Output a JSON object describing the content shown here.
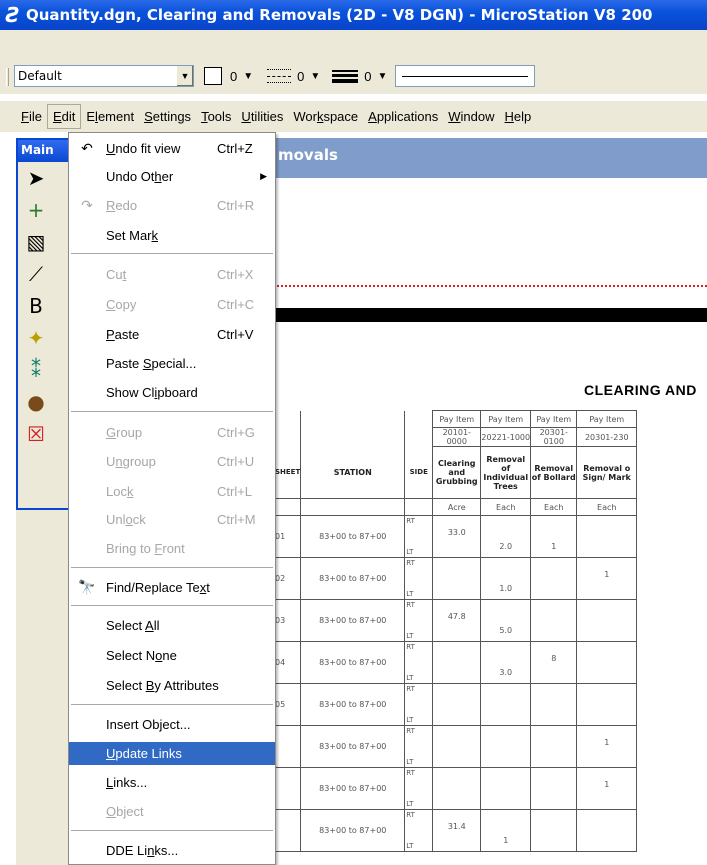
{
  "window": {
    "logo": "Ƨ",
    "title": "Quantity.dgn, Clearing and Removals (2D - V8 DGN) - MicroStation V8 200"
  },
  "toolbar": {
    "level_value": "Default",
    "color_value": "0",
    "style_value": "0",
    "weight_value": "0"
  },
  "menubar": {
    "items": [
      {
        "pre": "",
        "key": "F",
        "post": "ile"
      },
      {
        "pre": "",
        "key": "E",
        "post": "dit"
      },
      {
        "pre": "E",
        "key": "l",
        "post": "ement"
      },
      {
        "pre": "",
        "key": "S",
        "post": "ettings"
      },
      {
        "pre": "",
        "key": "T",
        "post": "ools"
      },
      {
        "pre": "",
        "key": "U",
        "post": "tilities"
      },
      {
        "pre": "Wor",
        "key": "k",
        "post": "space"
      },
      {
        "pre": "",
        "key": "A",
        "post": "pplications"
      },
      {
        "pre": "",
        "key": "W",
        "post": "indow"
      },
      {
        "pre": "",
        "key": "H",
        "post": "elp"
      }
    ]
  },
  "palette": {
    "title": "Main",
    "tools": [
      "select-icon",
      "crosshair-icon",
      "fence-icon",
      "line-icon",
      "text-icon",
      "point-icon",
      "measure-icon",
      "palette-icon",
      "delete-icon"
    ]
  },
  "view": {
    "title": "movals",
    "sheet_title": "CLEARING AND"
  },
  "table": {
    "pay_item_label": "Pay Item",
    "pay_items": [
      "20101-0000",
      "20221-1000",
      "20301-0100",
      "20301-230"
    ],
    "sheet_header": "SHEET",
    "station_header": "STATION",
    "side_header": "SIDE",
    "col_names": [
      "Clearing and Grubbing",
      "Removal of Individual Trees",
      "Removal of Bollard",
      "Removal o Sign/ Mark"
    ],
    "units": [
      "Acre",
      "Each",
      "Each",
      "Each"
    ],
    "rt": "RT",
    "lt": "LT",
    "rows": [
      {
        "sheet": "01",
        "station": "83+00 to 87+00",
        "vals": [
          "33.0",
          "2.0",
          "1",
          ""
        ]
      },
      {
        "sheet": "02",
        "station": "83+00 to 87+00",
        "vals": [
          "",
          "1.0",
          "",
          "1"
        ]
      },
      {
        "sheet": "03",
        "station": "83+00 to 87+00",
        "vals": [
          "47.8",
          "5.0",
          "",
          ""
        ]
      },
      {
        "sheet": "04",
        "station": "83+00 to 87+00",
        "vals": [
          "",
          "3.0",
          "8",
          ""
        ]
      },
      {
        "sheet": "05",
        "station": "83+00 to 87+00",
        "vals": [
          "",
          "",
          "",
          ""
        ]
      },
      {
        "sheet": "",
        "station": "83+00 to 87+00",
        "vals": [
          "",
          "",
          "",
          "1"
        ]
      },
      {
        "sheet": "",
        "station": "83+00 to 87+00",
        "vals": [
          "",
          "",
          "",
          "1"
        ]
      },
      {
        "sheet": "",
        "station": "83+00 to 87+00",
        "vals": [
          "31.4",
          "1",
          "",
          ""
        ]
      }
    ]
  },
  "edit_menu": {
    "items": [
      {
        "id": "undo-fit-view",
        "pre": "",
        "key": "U",
        "post": "ndo fit view",
        "shortcut": "Ctrl+Z",
        "icon": "↶",
        "disabled": false
      },
      {
        "id": "undo-other",
        "pre": "Undo Ot",
        "key": "h",
        "post": "er",
        "shortcut": "",
        "icon": "",
        "disabled": false,
        "submenu": "▶"
      },
      {
        "id": "redo",
        "pre": "",
        "key": "R",
        "post": "edo",
        "shortcut": "Ctrl+R",
        "icon": "↷",
        "disabled": true
      },
      {
        "id": "set-mark",
        "pre": "Set Mar",
        "key": "k",
        "post": "",
        "shortcut": "",
        "icon": "",
        "disabled": false
      },
      {
        "id": "cut",
        "pre": "Cu",
        "key": "t",
        "post": "",
        "shortcut": "Ctrl+X",
        "icon": "",
        "disabled": true
      },
      {
        "id": "copy",
        "pre": "",
        "key": "C",
        "post": "opy",
        "shortcut": "Ctrl+C",
        "icon": "",
        "disabled": true
      },
      {
        "id": "paste",
        "pre": "",
        "key": "P",
        "post": "aste",
        "shortcut": "Ctrl+V",
        "icon": "",
        "disabled": false
      },
      {
        "id": "paste-special",
        "pre": "Paste ",
        "key": "S",
        "post": "pecial...",
        "shortcut": "",
        "icon": "",
        "disabled": false
      },
      {
        "id": "show-clipboard",
        "pre": "Show Cl",
        "key": "i",
        "post": "pboard",
        "shortcut": "",
        "icon": "",
        "disabled": false
      },
      {
        "id": "group",
        "pre": "",
        "key": "G",
        "post": "roup",
        "shortcut": "Ctrl+G",
        "icon": "",
        "disabled": true
      },
      {
        "id": "ungroup",
        "pre": "U",
        "key": "n",
        "post": "group",
        "shortcut": "Ctrl+U",
        "icon": "",
        "disabled": true
      },
      {
        "id": "lock",
        "pre": "Loc",
        "key": "k",
        "post": "",
        "shortcut": "Ctrl+L",
        "icon": "",
        "disabled": true
      },
      {
        "id": "unlock",
        "pre": "Unl",
        "key": "o",
        "post": "ck",
        "shortcut": "Ctrl+M",
        "icon": "",
        "disabled": true
      },
      {
        "id": "bring-to-front",
        "pre": "Bring to ",
        "key": "F",
        "post": "ront",
        "shortcut": "",
        "icon": "",
        "disabled": true
      },
      {
        "id": "find-replace-text",
        "pre": "Find/Replace Te",
        "key": "x",
        "post": "t",
        "shortcut": "",
        "icon": "🔭",
        "disabled": false
      },
      {
        "id": "select-all",
        "pre": "Select ",
        "key": "A",
        "post": "ll",
        "shortcut": "",
        "icon": "",
        "disabled": false
      },
      {
        "id": "select-none",
        "pre": "Select N",
        "key": "o",
        "post": "ne",
        "shortcut": "",
        "icon": "",
        "disabled": false
      },
      {
        "id": "select-by-attributes",
        "pre": "Select ",
        "key": "B",
        "post": "y Attributes",
        "shortcut": "",
        "icon": "",
        "disabled": false
      },
      {
        "id": "insert-object",
        "pre": "Insert Ob",
        "key": "j",
        "post": "ect...",
        "shortcut": "",
        "icon": "",
        "disabled": false
      },
      {
        "id": "update-links",
        "pre": "",
        "key": "U",
        "post": "pdate Links",
        "shortcut": "",
        "icon": "",
        "disabled": false,
        "highlighted": true
      },
      {
        "id": "links",
        "pre": "",
        "key": "L",
        "post": "inks...",
        "shortcut": "",
        "icon": "",
        "disabled": false
      },
      {
        "id": "object",
        "pre": "",
        "key": "O",
        "post": "bject",
        "shortcut": "",
        "icon": "",
        "disabled": true
      },
      {
        "id": "dde-links",
        "pre": "DDE Li",
        "key": "n",
        "post": "ks...",
        "shortcut": "",
        "icon": "",
        "disabled": false
      }
    ]
  }
}
